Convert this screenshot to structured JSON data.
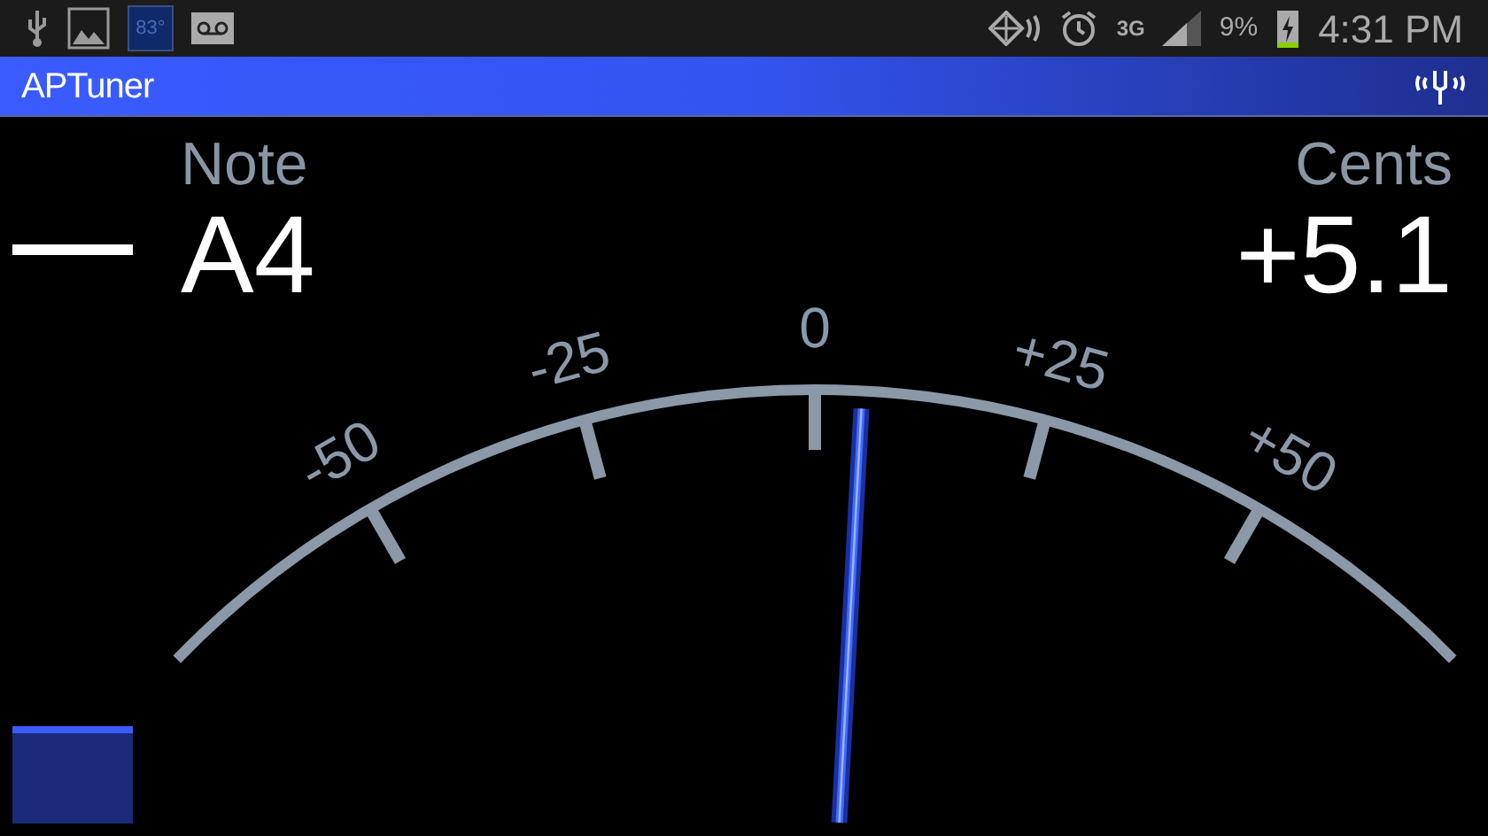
{
  "status_bar": {
    "temperature": "83°",
    "network": "3G",
    "battery_percent": "9%",
    "time": "4:31 PM"
  },
  "title_bar": {
    "title": "APTuner"
  },
  "note": {
    "label": "Note",
    "value": "A4"
  },
  "cents": {
    "label": "Cents",
    "value": "+5.1"
  },
  "gauge": {
    "ticks": [
      {
        "label": "-50"
      },
      {
        "label": "-25"
      },
      {
        "label": "0"
      },
      {
        "label": "+25"
      },
      {
        "label": "+50"
      }
    ],
    "needle": {
      "level": 0.551
    }
  }
}
